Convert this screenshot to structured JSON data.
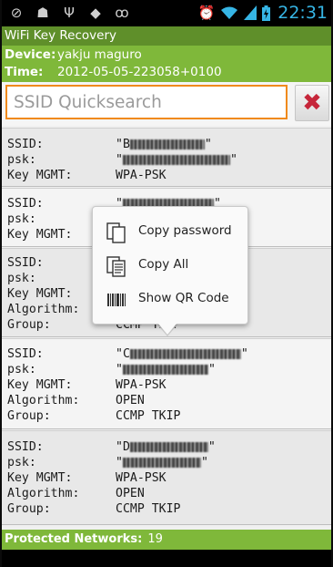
{
  "status_bar": {
    "time": "22:31",
    "icons_left": [
      "blocked-icon",
      "android-debug-icon",
      "usb-icon",
      "app-icon",
      "voicemail-icon"
    ],
    "icons_right": [
      "alarm-icon",
      "wifi-icon",
      "signal-icon",
      "battery-icon"
    ]
  },
  "app": {
    "title": "WiFi Key Recovery"
  },
  "device_info": {
    "device_label": "Device:",
    "device_value": "yakju maguro",
    "time_label": "Time:",
    "time_value": "2012-05-05-223058+0100"
  },
  "search": {
    "placeholder": "SSID Quicksearch",
    "clear_symbol": "✖"
  },
  "labels": {
    "ssid": "SSID:",
    "psk": "psk:",
    "key_mgmt": "Key MGMT:",
    "algorithm": "Algorithm:",
    "group": "Group:"
  },
  "networks": [
    {
      "ssid_visible": "\"B",
      "psk_visible": "\"",
      "key_mgmt": "WPA-PSK"
    },
    {
      "ssid_visible": "\"",
      "psk_visible": "",
      "key_mgmt": ""
    },
    {
      "ssid_visible": "",
      "psk_visible": "",
      "key_mgmt": "",
      "algorithm": "",
      "group": "CCMP TKIP"
    },
    {
      "ssid_visible": "\"C",
      "psk_visible": "\"",
      "key_mgmt": "WPA-PSK",
      "algorithm": "OPEN",
      "group": "CCMP TKIP"
    },
    {
      "ssid_visible": "\"D",
      "psk_visible": "\"",
      "key_mgmt": "WPA-PSK",
      "algorithm": "OPEN",
      "group": "CCMP TKIP"
    }
  ],
  "context_menu": {
    "items": [
      {
        "label": "Copy password",
        "icon": "copy-password-icon"
      },
      {
        "label": "Copy All",
        "icon": "copy-all-icon"
      },
      {
        "label": "Show QR Code",
        "icon": "qr-code-icon"
      }
    ]
  },
  "footer": {
    "label": "Protected Networks:",
    "count": "19"
  },
  "colors": {
    "title_bar": "#5f8f2a",
    "info_bar": "#7fb83a",
    "search_border": "#f08a1c",
    "clear_button_x": "#c6263a",
    "status_accent": "#36b5e5"
  }
}
